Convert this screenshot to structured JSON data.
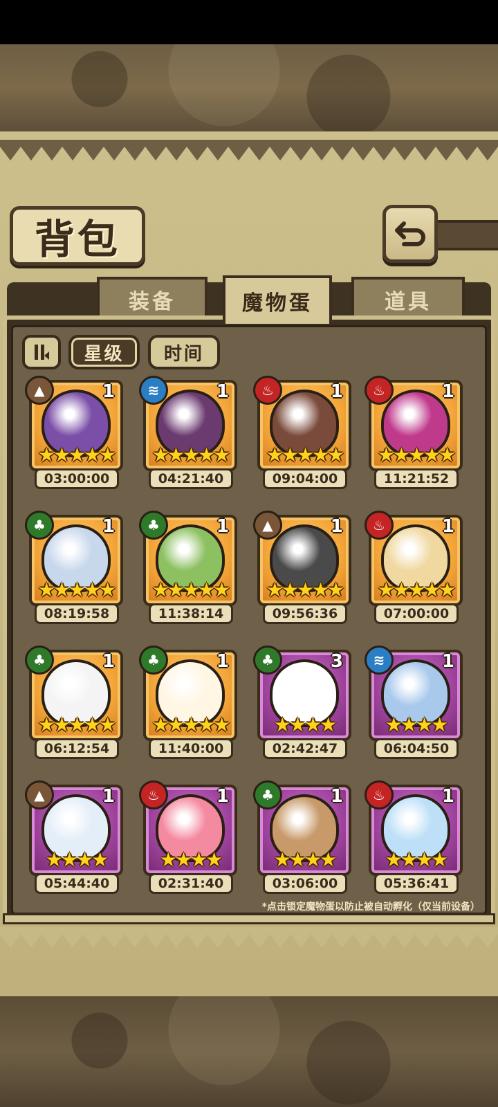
{
  "header": {
    "title": "背包",
    "back_icon": "return-arrow-icon"
  },
  "tabs": [
    {
      "label": "装备",
      "active": false
    },
    {
      "label": "魔物蛋",
      "active": true
    },
    {
      "label": "道具",
      "active": false
    }
  ],
  "sort": {
    "star_label": "星级",
    "time_label": "时间",
    "active": "星级"
  },
  "eggs": [
    {
      "element": "earth",
      "rarity": "gold",
      "count": "1",
      "stars": "★★★★★",
      "timer": "03:00:00",
      "color": "#7b4fa8"
    },
    {
      "element": "water",
      "rarity": "gold",
      "count": "1",
      "stars": "★★★★★",
      "timer": "04:21:40",
      "color": "#6b3a6f"
    },
    {
      "element": "fire",
      "rarity": "gold",
      "count": "1",
      "stars": "★★★★★",
      "timer": "09:04:00",
      "color": "#7a4a3a"
    },
    {
      "element": "fire",
      "rarity": "gold",
      "count": "1",
      "stars": "★★★★★",
      "timer": "11:21:52",
      "color": "#c03a8c"
    },
    {
      "element": "grass",
      "rarity": "gold",
      "count": "1",
      "stars": "★★★★★",
      "timer": "08:19:58",
      "color": "#c8d8ec"
    },
    {
      "element": "grass",
      "rarity": "gold",
      "count": "1",
      "stars": "★★★★★",
      "timer": "11:38:14",
      "color": "#8cc060"
    },
    {
      "element": "earth",
      "rarity": "gold",
      "count": "1",
      "stars": "★★★★★",
      "timer": "09:56:36",
      "color": "#4a4a4a"
    },
    {
      "element": "fire",
      "rarity": "gold",
      "count": "1",
      "stars": "★★★★★",
      "timer": "07:00:00",
      "color": "#f0d8a0"
    },
    {
      "element": "grass",
      "rarity": "gold",
      "count": "1",
      "stars": "★★★★★",
      "timer": "06:12:54",
      "color": "#f4f4f4"
    },
    {
      "element": "grass",
      "rarity": "gold",
      "count": "1",
      "stars": "★★★★★",
      "timer": "11:40:00",
      "color": "#fff6e4"
    },
    {
      "element": "grass",
      "rarity": "purple",
      "count": "3",
      "stars": "★★★★",
      "timer": "02:42:47",
      "color": "#ffffff"
    },
    {
      "element": "water",
      "rarity": "purple",
      "count": "1",
      "stars": "★★★★",
      "timer": "06:04:50",
      "color": "#a8c8ec"
    },
    {
      "element": "earth",
      "rarity": "purple",
      "count": "1",
      "stars": "★★★★",
      "timer": "05:44:40",
      "color": "#e4eef8"
    },
    {
      "element": "fire",
      "rarity": "purple",
      "count": "1",
      "stars": "★★★★",
      "timer": "02:31:40",
      "color": "#f48aa0"
    },
    {
      "element": "grass",
      "rarity": "purple",
      "count": "1",
      "stars": "★★★★",
      "timer": "03:06:00",
      "color": "#c89a6a"
    },
    {
      "element": "fire",
      "rarity": "purple",
      "count": "1",
      "stars": "★★★★",
      "timer": "05:36:41",
      "color": "#bde0f8"
    }
  ],
  "footnote": "*点击锁定魔物蛋以防止被自动孵化（仅当前设备）"
}
